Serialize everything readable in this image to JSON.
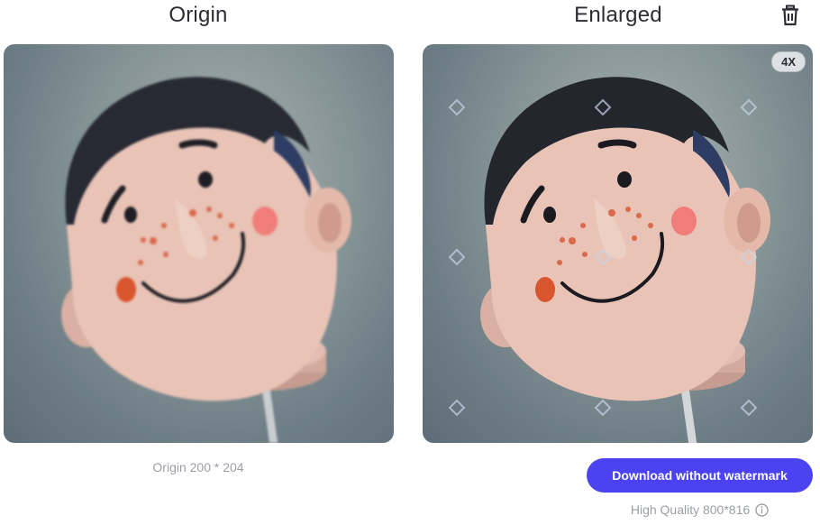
{
  "origin": {
    "title": "Origin",
    "dimensions": "Origin 200 * 204"
  },
  "enlarged": {
    "title": "Enlarged",
    "scale_badge": "4X",
    "download_label": "Download without watermark",
    "quality_text": "High Quality 800*816"
  },
  "icons": {
    "delete": "trash-icon",
    "info": "info-icon"
  },
  "colors": {
    "accent": "#4b43f2",
    "title_text": "#2b2d33",
    "muted_text": "#9a9ea5"
  }
}
